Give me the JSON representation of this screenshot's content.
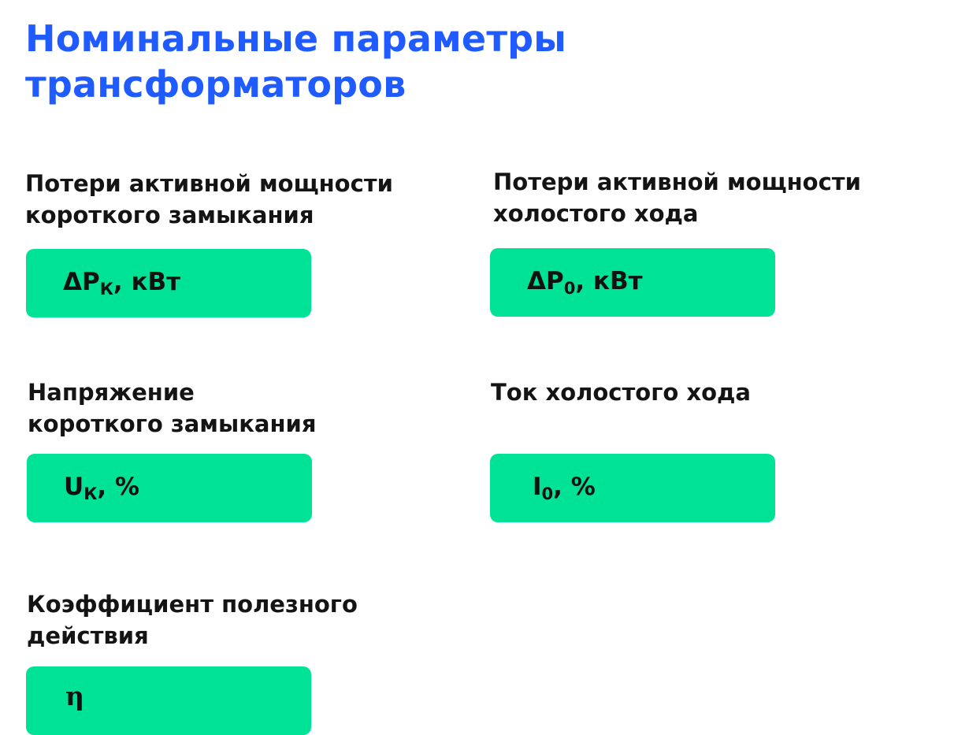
{
  "title": {
    "line1": "Номинальные параметры",
    "line2": "трансформаторов"
  },
  "params": [
    {
      "label_line1": "Потери активной мощности",
      "label_line2": "короткого замыкания",
      "symbol_main": "ΔP",
      "symbol_sub": "К",
      "symbol_tail": ", кВт"
    },
    {
      "label_line1": "Потери активной мощности",
      "label_line2": "холостого хода",
      "symbol_main": "ΔP",
      "symbol_sub": "0",
      "symbol_tail": ", кВт"
    },
    {
      "label_line1": "Напряжение",
      "label_line2": "короткого замыкания",
      "symbol_main": "U",
      "symbol_sub": "К",
      "symbol_tail": ", %"
    },
    {
      "label_line1": "Ток холостого хода",
      "label_line2": "",
      "symbol_main": "I",
      "symbol_sub": "0",
      "symbol_tail": ", %"
    },
    {
      "label_line1": "Коэффициент полезного",
      "label_line2": "действия",
      "symbol_main": "η",
      "symbol_sub": "",
      "symbol_tail": ""
    }
  ],
  "colors": {
    "title": "#1f5bff",
    "box": "#00e396",
    "text": "#141414"
  }
}
